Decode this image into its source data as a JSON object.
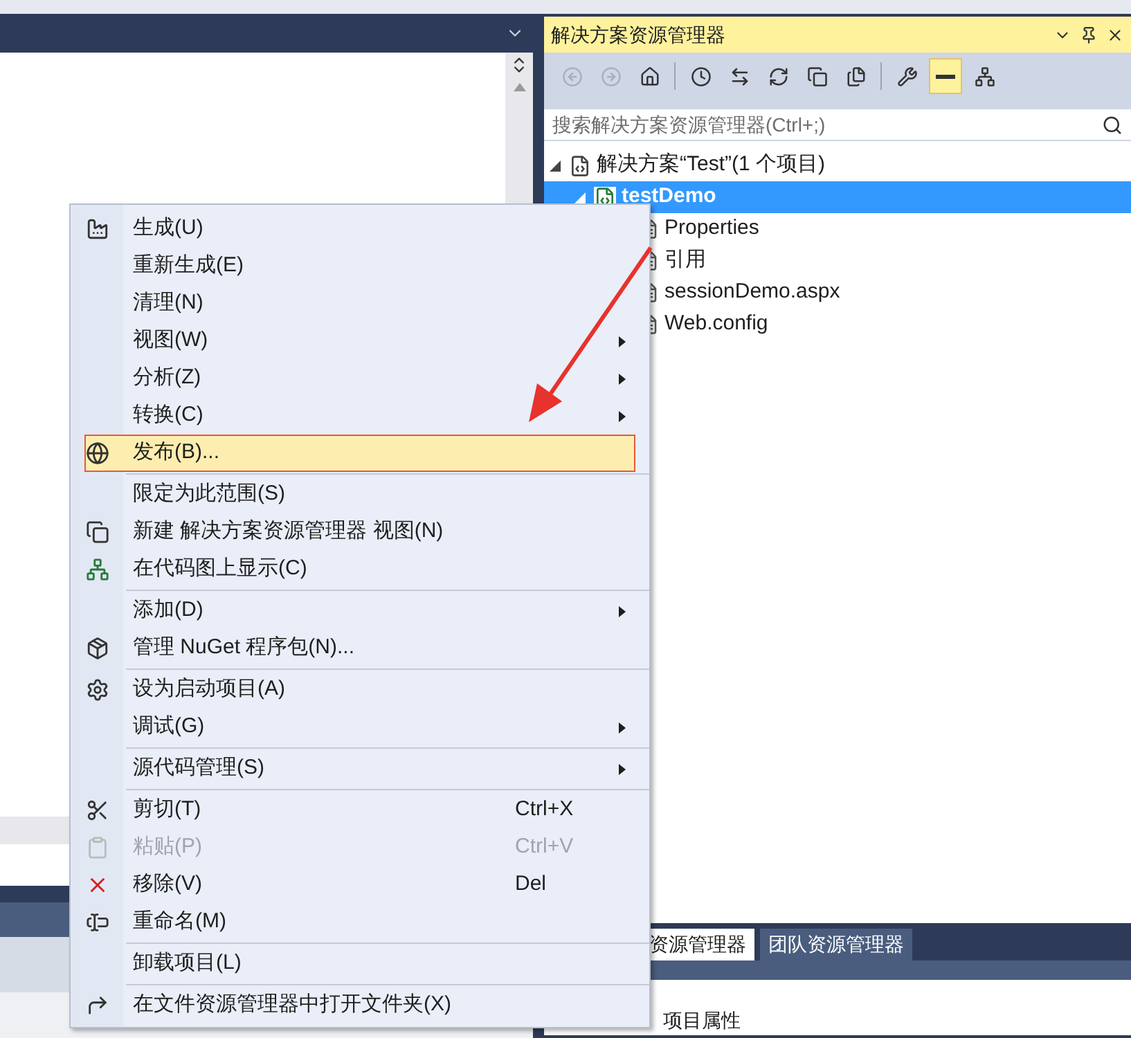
{
  "solution_explorer": {
    "title": "解决方案资源管理器",
    "toolbar": [
      {
        "disabled": true,
        "selected": false
      },
      {
        "disabled": true,
        "selected": false
      },
      {
        "disabled": false,
        "selected": false
      },
      {
        "disabled": false,
        "selected": false
      },
      {
        "disabled": false,
        "selected": false
      },
      {
        "disabled": false,
        "selected": false
      },
      {
        "disabled": false,
        "selected": false
      },
      {
        "disabled": false,
        "selected": false
      },
      {
        "disabled": false,
        "selected": false
      },
      {
        "disabled": false,
        "selected": true
      },
      {
        "disabled": false,
        "selected": false
      }
    ],
    "search": {
      "placeholder": "搜索解决方案资源管理器(Ctrl+;)"
    },
    "tree": [
      {
        "label": "解决方案“Test”(1 个项目)",
        "selected": false,
        "expanded": true,
        "children": [
          {
            "label": "testDemo",
            "selected": true,
            "expanded": true,
            "children": [
              {
                "label": "Properties",
                "selected": false
              },
              {
                "label": "引用",
                "selected": false
              },
              {
                "label": "sessionDemo.aspx",
                "selected": false
              },
              {
                "label": "Web.config",
                "selected": false
              }
            ]
          }
        ]
      }
    ],
    "tabs": [
      {
        "label": "资源管理器",
        "selected": true
      },
      {
        "label": "团队资源管理器",
        "selected": false
      }
    ]
  },
  "properties_panel": {
    "label": "项目属性"
  },
  "context_menu": [
    {
      "kind": "item",
      "label": "生成(U)",
      "selected": false,
      "disabled": false,
      "submenu": false
    },
    {
      "kind": "item",
      "label": "重新生成(E)",
      "selected": false,
      "disabled": false,
      "submenu": false
    },
    {
      "kind": "item",
      "label": "清理(N)",
      "selected": false,
      "disabled": false,
      "submenu": false
    },
    {
      "kind": "item",
      "label": "视图(W)",
      "selected": false,
      "disabled": false,
      "submenu": true
    },
    {
      "kind": "item",
      "label": "分析(Z)",
      "selected": false,
      "disabled": false,
      "submenu": true
    },
    {
      "kind": "item",
      "label": "转换(C)",
      "selected": false,
      "disabled": false,
      "submenu": true
    },
    {
      "kind": "item",
      "label": "发布(B)...",
      "selected": true,
      "disabled": false,
      "submenu": false
    },
    {
      "kind": "separator"
    },
    {
      "kind": "item",
      "label": "限定为此范围(S)",
      "selected": false,
      "disabled": false,
      "submenu": false
    },
    {
      "kind": "item",
      "label": "新建 解决方案资源管理器 视图(N)",
      "selected": false,
      "disabled": false,
      "submenu": false
    },
    {
      "kind": "item",
      "label": "在代码图上显示(C)",
      "selected": false,
      "disabled": false,
      "submenu": false
    },
    {
      "kind": "separator"
    },
    {
      "kind": "item",
      "label": "添加(D)",
      "selected": false,
      "disabled": false,
      "submenu": true
    },
    {
      "kind": "item",
      "label": "管理 NuGet 程序包(N)...",
      "selected": false,
      "disabled": false,
      "submenu": false
    },
    {
      "kind": "separator"
    },
    {
      "kind": "item",
      "label": "设为启动项目(A)",
      "selected": false,
      "disabled": false,
      "submenu": false
    },
    {
      "kind": "item",
      "label": "调试(G)",
      "selected": false,
      "disabled": false,
      "submenu": true
    },
    {
      "kind": "separator"
    },
    {
      "kind": "item",
      "label": "源代码管理(S)",
      "selected": false,
      "disabled": false,
      "submenu": true
    },
    {
      "kind": "separator"
    },
    {
      "kind": "item",
      "label": "剪切(T)",
      "shortcut": "Ctrl+X",
      "selected": false,
      "disabled": false,
      "submenu": false
    },
    {
      "kind": "item",
      "label": "粘贴(P)",
      "shortcut": "Ctrl+V",
      "selected": false,
      "disabled": true,
      "submenu": false
    },
    {
      "kind": "item",
      "label": "移除(V)",
      "shortcut": "Del",
      "selected": false,
      "disabled": false,
      "submenu": false
    },
    {
      "kind": "item",
      "label": "重命名(M)",
      "selected": false,
      "disabled": false,
      "submenu": false
    },
    {
      "kind": "separator"
    },
    {
      "kind": "item",
      "label": "卸载项目(L)",
      "selected": false,
      "disabled": false,
      "submenu": false
    },
    {
      "kind": "separator"
    },
    {
      "kind": "item",
      "label": "在文件资源管理器中打开文件夹(X)",
      "selected": false,
      "disabled": false,
      "submenu": false
    }
  ]
}
